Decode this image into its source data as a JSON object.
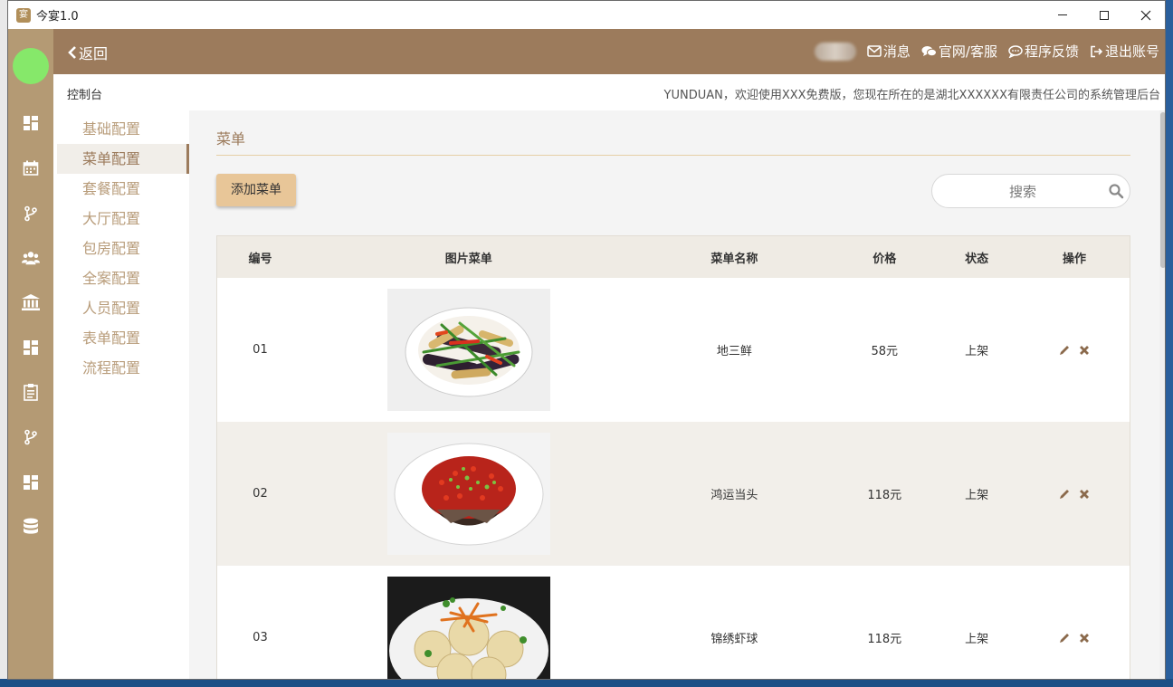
{
  "window": {
    "title": "今宴1.0",
    "icon_text": "宴"
  },
  "header": {
    "back_label": "返回",
    "nav": [
      {
        "label": "消息",
        "icon": "envelope-icon"
      },
      {
        "label": "官网/客服",
        "icon": "chat-bubbles-icon"
      },
      {
        "label": "程序反馈",
        "icon": "comment-icon"
      },
      {
        "label": "退出账号",
        "icon": "sign-out-icon"
      }
    ]
  },
  "breadcrumb": {
    "label": "控制台"
  },
  "welcome_text": "YUNDUAN，欢迎使用XXX免费版，您现在所在的是湖北XXXXXX有限责任公司的系统管理后台",
  "submenu": {
    "items": [
      "基础配置",
      "菜单配置",
      "套餐配置",
      "大厅配置",
      "包房配置",
      "全案配置",
      "人员配置",
      "表单配置",
      "流程配置"
    ],
    "active_index": 1
  },
  "main": {
    "section_title": "菜单",
    "add_button": "添加菜单",
    "search_placeholder": "搜索",
    "columns": [
      "编号",
      "图片菜单",
      "菜单名称",
      "价格",
      "状态",
      "操作"
    ],
    "rows": [
      {
        "no": "01",
        "name": "地三鲜",
        "price": "58元",
        "status": "上架"
      },
      {
        "no": "02",
        "name": "鸿运当头",
        "price": "118元",
        "status": "上架"
      },
      {
        "no": "03",
        "name": "锦绣虾球",
        "price": "118元",
        "status": "上架"
      }
    ]
  },
  "colors": {
    "header_bg": "#9c7b5c",
    "rail_bg": "#b49a74",
    "accent": "#e8c698",
    "avatar": "#86e86a"
  }
}
